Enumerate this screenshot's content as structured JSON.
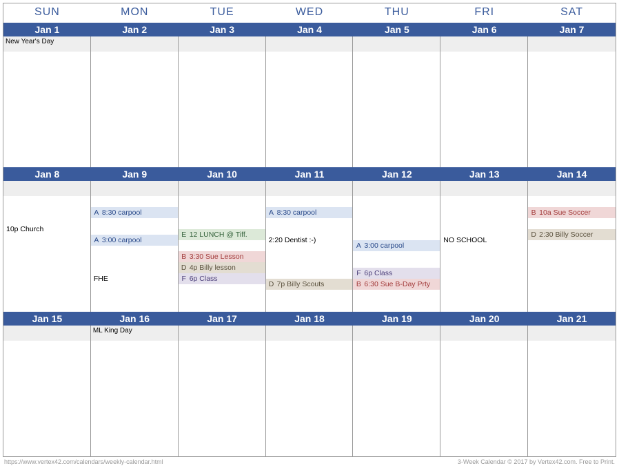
{
  "dayHeaders": [
    "SUN",
    "MON",
    "TUE",
    "WED",
    "THU",
    "FRI",
    "SAT"
  ],
  "weeks": [
    {
      "dates": [
        "Jan 1",
        "Jan 2",
        "Jan 3",
        "Jan 4",
        "Jan 5",
        "Jan 6",
        "Jan 7"
      ],
      "days": [
        {
          "holiday": "New Year's Day",
          "rows": []
        },
        {
          "holiday": "",
          "rows": []
        },
        {
          "holiday": "",
          "rows": []
        },
        {
          "holiday": "",
          "rows": []
        },
        {
          "holiday": "",
          "rows": []
        },
        {
          "holiday": "",
          "rows": []
        },
        {
          "holiday": "",
          "rows": []
        }
      ]
    },
    {
      "dates": [
        "Jan 8",
        "Jan 9",
        "Jan 10",
        "Jan 11",
        "Jan 12",
        "Jan 13",
        "Jan 14"
      ],
      "days": [
        {
          "holiday": "",
          "rows": [
            {
              "type": "spacer"
            },
            {
              "type": "spacer"
            },
            {
              "type": "hspacer"
            },
            {
              "type": "plain",
              "text": "10p  Church"
            }
          ]
        },
        {
          "holiday": "",
          "rows": [
            {
              "type": "spacer"
            },
            {
              "type": "event",
              "cat": "A",
              "tag": "A",
              "text": "8:30 carpool"
            },
            {
              "type": "spacer"
            },
            {
              "type": "hspacer"
            },
            {
              "type": "event",
              "cat": "A",
              "tag": "A",
              "text": "3:00 carpool"
            },
            {
              "type": "spacer"
            },
            {
              "type": "spacer"
            },
            {
              "type": "hspacer"
            },
            {
              "type": "plain",
              "text": "         FHE"
            }
          ]
        },
        {
          "holiday": "",
          "rows": [
            {
              "type": "spacer"
            },
            {
              "type": "spacer"
            },
            {
              "type": "spacer"
            },
            {
              "type": "event",
              "cat": "E",
              "tag": "E",
              "text": "12 LUNCH @ Tiff."
            },
            {
              "type": "spacer"
            },
            {
              "type": "event",
              "cat": "B",
              "tag": "B",
              "text": "3:30 Sue Lesson"
            },
            {
              "type": "event",
              "cat": "D",
              "tag": "D",
              "text": "4p Billy lesson"
            },
            {
              "type": "event",
              "cat": "F",
              "tag": "F",
              "text": "6p Class"
            }
          ]
        },
        {
          "holiday": "",
          "rows": [
            {
              "type": "spacer"
            },
            {
              "type": "event",
              "cat": "A",
              "tag": "A",
              "text": "8:30 carpool"
            },
            {
              "type": "spacer"
            },
            {
              "type": "hspacer"
            },
            {
              "type": "plain",
              "text": "2:20  Dentist :-)"
            },
            {
              "type": "spacer"
            },
            {
              "type": "spacer"
            },
            {
              "type": "spacer"
            },
            {
              "type": "event",
              "cat": "D",
              "tag": "D",
              "text": "7p Billy Scouts"
            }
          ]
        },
        {
          "holiday": "",
          "rows": [
            {
              "type": "spacer"
            },
            {
              "type": "spacer"
            },
            {
              "type": "spacer"
            },
            {
              "type": "spacer"
            },
            {
              "type": "event",
              "cat": "A",
              "tag": "A",
              "text": "3:00 carpool"
            },
            {
              "type": "spacer"
            },
            {
              "type": "hspacer"
            },
            {
              "type": "event",
              "cat": "F",
              "tag": "F",
              "text": "6p Class"
            },
            {
              "type": "event",
              "cat": "B",
              "tag": "B",
              "text": "6:30 Sue B-Day Prty"
            }
          ]
        },
        {
          "holiday": "",
          "rows": [
            {
              "type": "spacer"
            },
            {
              "type": "spacer"
            },
            {
              "type": "spacer"
            },
            {
              "type": "hspacer"
            },
            {
              "type": "plain",
              "text": "         NO SCHOOL"
            }
          ]
        },
        {
          "holiday": "",
          "rows": [
            {
              "type": "spacer"
            },
            {
              "type": "event",
              "cat": "B",
              "tag": "B",
              "text": "10a Sue Soccer"
            },
            {
              "type": "spacer"
            },
            {
              "type": "event",
              "cat": "D",
              "tag": "D",
              "text": "2:30 Billy Soccer"
            }
          ]
        }
      ]
    },
    {
      "dates": [
        "Jan 15",
        "Jan 16",
        "Jan 17",
        "Jan 18",
        "Jan 19",
        "Jan 20",
        "Jan 21"
      ],
      "days": [
        {
          "holiday": "",
          "rows": []
        },
        {
          "holiday": "ML King Day",
          "rows": []
        },
        {
          "holiday": "",
          "rows": []
        },
        {
          "holiday": "",
          "rows": []
        },
        {
          "holiday": "",
          "rows": []
        },
        {
          "holiday": "",
          "rows": []
        },
        {
          "holiday": "",
          "rows": []
        }
      ]
    }
  ],
  "footer": {
    "left": "https://www.vertex42.com/calendars/weekly-calendar.html",
    "right": "3-Week Calendar © 2017 by Vertex42.com. Free to Print."
  }
}
